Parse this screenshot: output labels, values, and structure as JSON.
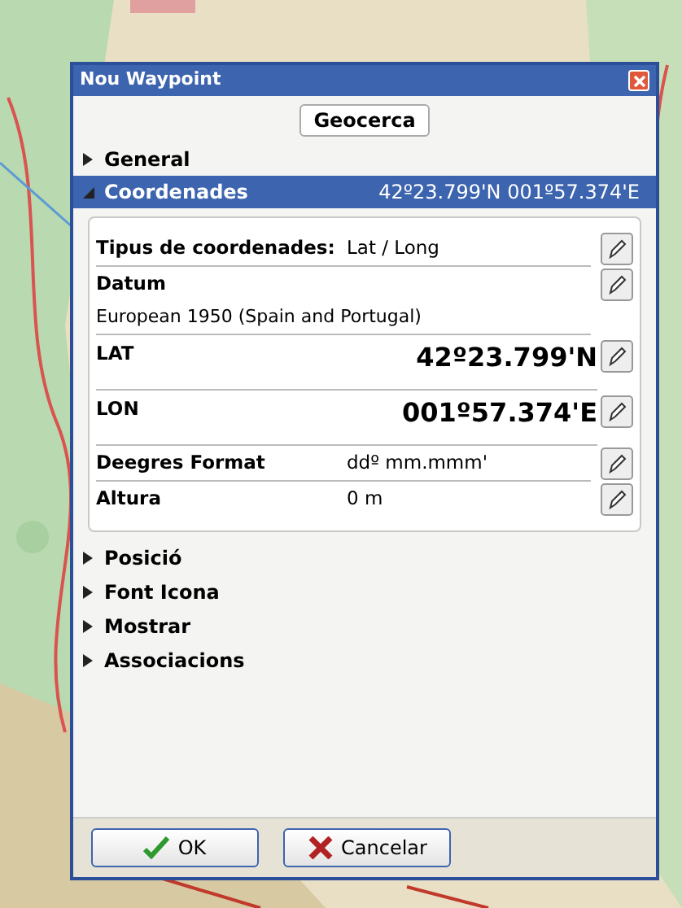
{
  "window": {
    "title": "Nou Waypoint"
  },
  "geofence_button": "Geocerca",
  "sections": [
    {
      "label": "General",
      "expanded": false
    },
    {
      "label": "Coordenades",
      "expanded": true,
      "summary": "42º23.799'N 001º57.374'E",
      "fields": [
        {
          "kind": "inline",
          "label": "Tipus de coordenades:",
          "value": "Lat / Long"
        },
        {
          "kind": "stacked",
          "label": "Datum",
          "value": "European 1950 (Spain and Portugal)"
        },
        {
          "kind": "coord",
          "label": "LAT",
          "value": "42º23.799'N"
        },
        {
          "kind": "coord",
          "label": "LON",
          "value": "001º57.374'E"
        },
        {
          "kind": "inline",
          "label": "Deegres Format",
          "value": "ddº mm.mmm'"
        },
        {
          "kind": "inline",
          "label": "Altura",
          "value": "0 m"
        }
      ]
    },
    {
      "label": "Posició",
      "expanded": false
    },
    {
      "label": "Font  Icona",
      "expanded": false
    },
    {
      "label": "Mostrar",
      "expanded": false
    },
    {
      "label": "Associacions",
      "expanded": false
    }
  ],
  "buttons": [
    {
      "kind": "ok",
      "label": "OK"
    },
    {
      "kind": "cancel",
      "label": "Cancelar"
    }
  ]
}
